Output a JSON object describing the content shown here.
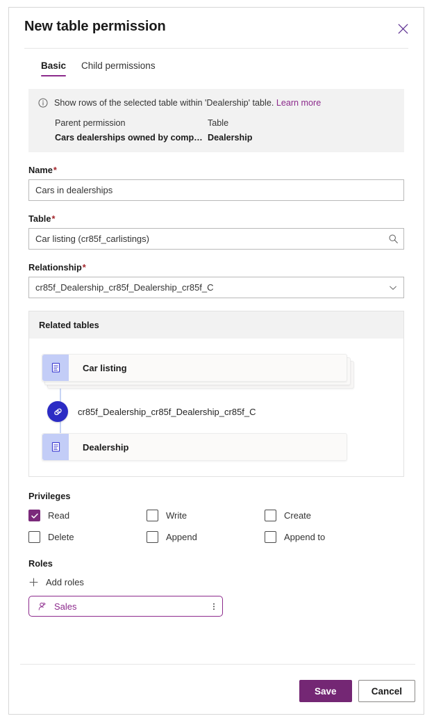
{
  "dialog": {
    "title": "New table permission",
    "close_icon": "close-icon"
  },
  "tabs": [
    {
      "label": "Basic",
      "active": true
    },
    {
      "label": "Child permissions",
      "active": false
    }
  ],
  "info_banner": {
    "icon": "info-circle-icon",
    "message": "Show rows of the selected table within 'Dealership' table.",
    "learn_more": "Learn more",
    "columns": [
      {
        "header": "Parent permission",
        "value": "Cars dealerships owned by compa..."
      },
      {
        "header": "Table",
        "value": "Dealership"
      }
    ]
  },
  "fields": {
    "name": {
      "label": "Name",
      "required": "*",
      "value": "Cars in dealerships",
      "placeholder": ""
    },
    "table": {
      "label": "Table",
      "required": "*",
      "value": "Car listing (cr85f_carlistings)",
      "placeholder": "",
      "affix_icon": "search-icon"
    },
    "relationship": {
      "label": "Relationship",
      "required": "*",
      "value": "cr85f_Dealership_cr85f_Dealership_cr85f_C",
      "affix_icon": "chevron-down-icon"
    }
  },
  "related_tables": {
    "header": "Related tables",
    "source_table": "Car listing",
    "relationship_name": "cr85f_Dealership_cr85f_Dealership_cr85f_C",
    "target_table": "Dealership",
    "table_icon": "table-icon",
    "link_icon": "link-rings-icon"
  },
  "privileges": {
    "label": "Privileges",
    "items": [
      {
        "label": "Read",
        "checked": true
      },
      {
        "label": "Write",
        "checked": false
      },
      {
        "label": "Create",
        "checked": false
      },
      {
        "label": "Delete",
        "checked": false
      },
      {
        "label": "Append",
        "checked": false
      },
      {
        "label": "Append to",
        "checked": false
      }
    ]
  },
  "roles": {
    "label": "Roles",
    "add_label": "Add roles",
    "add_icon": "plus-icon",
    "chips": [
      {
        "label": "Sales",
        "icon": "person-icon",
        "menu_icon": "more-vertical-icon"
      }
    ]
  },
  "footer": {
    "save_label": "Save",
    "cancel_label": "Cancel"
  },
  "colors": {
    "accent_purple": "#742774",
    "tab_underline": "#8c2a8c",
    "link_purple": "#8c2a8c",
    "checkbox_checked": "#7b2a7b",
    "relationship_badge": "#2b2bc4",
    "entity_icon_bg": "#c3cdf7",
    "banner_bg": "#f2f2f2",
    "required_star": "#a4262c"
  }
}
